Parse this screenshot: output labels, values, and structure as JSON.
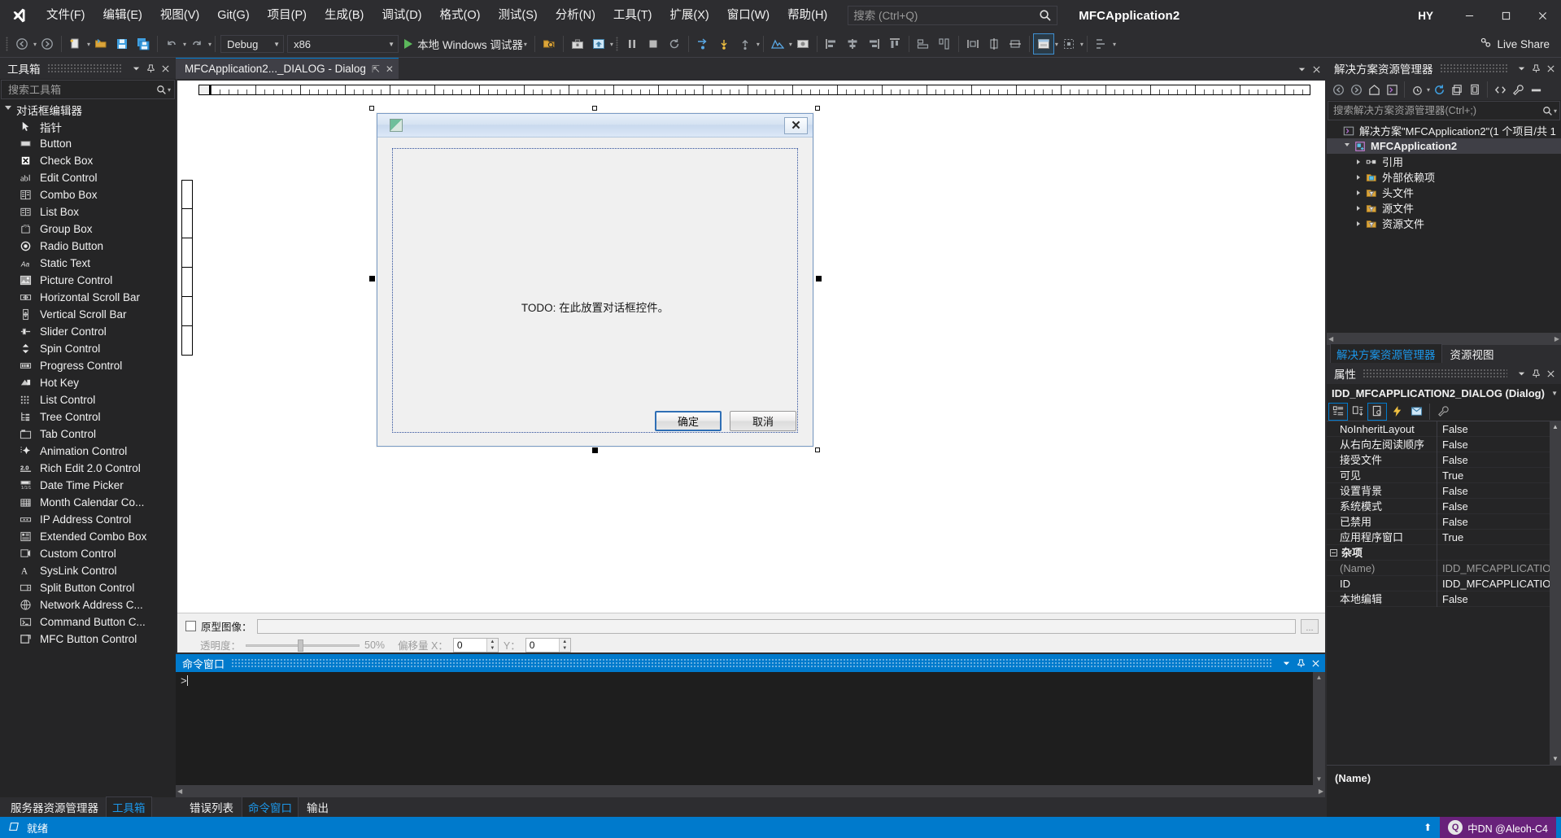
{
  "titlebar": {
    "menus": [
      {
        "label": "文件(F)"
      },
      {
        "label": "编辑(E)"
      },
      {
        "label": "视图(V)"
      },
      {
        "label": "Git(G)"
      },
      {
        "label": "项目(P)"
      },
      {
        "label": "生成(B)"
      },
      {
        "label": "调试(D)"
      },
      {
        "label": "格式(O)"
      },
      {
        "label": "测试(S)"
      },
      {
        "label": "分析(N)"
      },
      {
        "label": "工具(T)"
      },
      {
        "label": "扩展(X)"
      },
      {
        "label": "窗口(W)"
      },
      {
        "label": "帮助(H)"
      }
    ],
    "search_placeholder": "搜索 (Ctrl+Q)",
    "search_value": "",
    "app_title": "MFCApplication2",
    "account_initials": "HY",
    "window_minimize": "–",
    "window_maximize": "▢",
    "window_close": "✕"
  },
  "toolbar": {
    "config": "Debug",
    "platform": "x86",
    "run_label": "本地 Windows 调试器",
    "live_share": "Live Share"
  },
  "toolbox": {
    "title": "工具箱",
    "search_placeholder": "搜索工具箱",
    "group": "对话框编辑器",
    "items": [
      {
        "label": "指针",
        "icon": "pointer-icon"
      },
      {
        "label": "Button",
        "icon": "button-icon"
      },
      {
        "label": "Check Box",
        "icon": "checkbox-icon"
      },
      {
        "label": "Edit Control",
        "icon": "edit-control-icon"
      },
      {
        "label": "Combo Box",
        "icon": "combo-box-icon"
      },
      {
        "label": "List Box",
        "icon": "list-box-icon"
      },
      {
        "label": "Group Box",
        "icon": "group-box-icon"
      },
      {
        "label": "Radio Button",
        "icon": "radio-button-icon"
      },
      {
        "label": "Static Text",
        "icon": "static-text-icon"
      },
      {
        "label": "Picture Control",
        "icon": "picture-control-icon"
      },
      {
        "label": "Horizontal Scroll Bar",
        "icon": "hscrollbar-icon"
      },
      {
        "label": "Vertical Scroll Bar",
        "icon": "vscrollbar-icon"
      },
      {
        "label": "Slider Control",
        "icon": "slider-icon"
      },
      {
        "label": "Spin Control",
        "icon": "spin-icon"
      },
      {
        "label": "Progress Control",
        "icon": "progress-icon"
      },
      {
        "label": "Hot Key",
        "icon": "hotkey-icon"
      },
      {
        "label": "List Control",
        "icon": "list-control-icon"
      },
      {
        "label": "Tree Control",
        "icon": "tree-control-icon"
      },
      {
        "label": "Tab Control",
        "icon": "tab-control-icon"
      },
      {
        "label": "Animation Control",
        "icon": "animation-icon"
      },
      {
        "label": "Rich Edit 2.0 Control",
        "icon": "rich-edit-icon"
      },
      {
        "label": "Date Time Picker",
        "icon": "date-time-icon"
      },
      {
        "label": "Month Calendar Co...",
        "icon": "month-calendar-icon"
      },
      {
        "label": "IP Address Control",
        "icon": "ip-address-icon"
      },
      {
        "label": "Extended Combo Box",
        "icon": "extended-combo-icon"
      },
      {
        "label": "Custom Control",
        "icon": "custom-control-icon"
      },
      {
        "label": "SysLink Control",
        "icon": "syslink-icon"
      },
      {
        "label": "Split Button Control",
        "icon": "split-button-icon"
      },
      {
        "label": "Network Address C...",
        "icon": "network-address-icon"
      },
      {
        "label": "Command Button C...",
        "icon": "command-button-icon"
      },
      {
        "label": "MFC Button Control",
        "icon": "mfc-button-icon"
      }
    ],
    "bottom_tabs": [
      {
        "label": "服务器资源管理器",
        "selected": false
      },
      {
        "label": "工具箱",
        "selected": true
      }
    ]
  },
  "designer": {
    "tab_label": "MFCApplication2..._DIALOG - Dialog",
    "dialog": {
      "todo_text": "TODO: 在此放置对话框控件。",
      "ok_label": "确定",
      "cancel_label": "取消",
      "close_glyph": "✕"
    },
    "prototype": {
      "checkbox_label": "原型图像：",
      "path_value": "",
      "browse_label": "...",
      "opacity_label": "透明度：",
      "opacity_value": "50%",
      "offset_label": "偏移量 X：",
      "offset_x": "0",
      "offset_y_label": "Y：",
      "offset_y": "0"
    }
  },
  "command_window": {
    "title": "命令窗口",
    "prompt": ">"
  },
  "center_bottom_tabs": [
    {
      "label": "错误列表",
      "selected": false
    },
    {
      "label": "命令窗口",
      "selected": true
    },
    {
      "label": "输出",
      "selected": false
    }
  ],
  "solution_explorer": {
    "title": "解决方案资源管理器",
    "search_placeholder": "搜索解决方案资源管理器(Ctrl+;)",
    "tree": [
      {
        "label": "解决方案\"MFCApplication2\"(1 个项目/共 1 ",
        "level": 0,
        "expandable": false,
        "icon": "solution-icon",
        "selected": false
      },
      {
        "label": "MFCApplication2",
        "level": 1,
        "expandable": true,
        "expanded": true,
        "icon": "project-icon",
        "selected": true
      },
      {
        "label": "引用",
        "level": 2,
        "expandable": true,
        "expanded": false,
        "icon": "references-icon",
        "selected": false
      },
      {
        "label": "外部依赖项",
        "level": 2,
        "expandable": true,
        "expanded": false,
        "icon": "external-deps-icon",
        "selected": false
      },
      {
        "label": "头文件",
        "level": 2,
        "expandable": true,
        "expanded": false,
        "icon": "folder-filter-icon",
        "selected": false
      },
      {
        "label": "源文件",
        "level": 2,
        "expandable": true,
        "expanded": false,
        "icon": "folder-filter-icon",
        "selected": false
      },
      {
        "label": "资源文件",
        "level": 2,
        "expandable": true,
        "expanded": false,
        "icon": "folder-filter-icon",
        "selected": false
      }
    ],
    "tabs": [
      {
        "label": "解决方案资源管理器",
        "selected": true
      },
      {
        "label": "资源视图",
        "selected": false
      }
    ]
  },
  "properties": {
    "title": "属性",
    "selection": "IDD_MFCAPPLICATION2_DIALOG (Dialog)",
    "rows": [
      {
        "name": "NoInheritLayout",
        "value": "False",
        "category": false,
        "dim": false
      },
      {
        "name": "从右向左阅读顺序",
        "value": "False",
        "category": false,
        "dim": false
      },
      {
        "name": "接受文件",
        "value": "False",
        "category": false,
        "dim": false
      },
      {
        "name": "可见",
        "value": "True",
        "category": false,
        "dim": false
      },
      {
        "name": "设置背景",
        "value": "False",
        "category": false,
        "dim": false
      },
      {
        "name": "系统模式",
        "value": "False",
        "category": false,
        "dim": false
      },
      {
        "name": "已禁用",
        "value": "False",
        "category": false,
        "dim": false
      },
      {
        "name": "应用程序窗口",
        "value": "True",
        "category": false,
        "dim": false
      },
      {
        "name": "杂项",
        "value": "",
        "category": true,
        "dim": false
      },
      {
        "name": "(Name)",
        "value": "IDD_MFCAPPLICATIO",
        "category": false,
        "dim": true
      },
      {
        "name": "ID",
        "value": "IDD_MFCAPPLICATIO",
        "category": false,
        "dim": false
      },
      {
        "name": "本地编辑",
        "value": "False",
        "category": false,
        "dim": false
      }
    ],
    "description": "(Name)"
  },
  "status": {
    "text": "就绪",
    "notification": "中DN @Aleoh-C4"
  }
}
